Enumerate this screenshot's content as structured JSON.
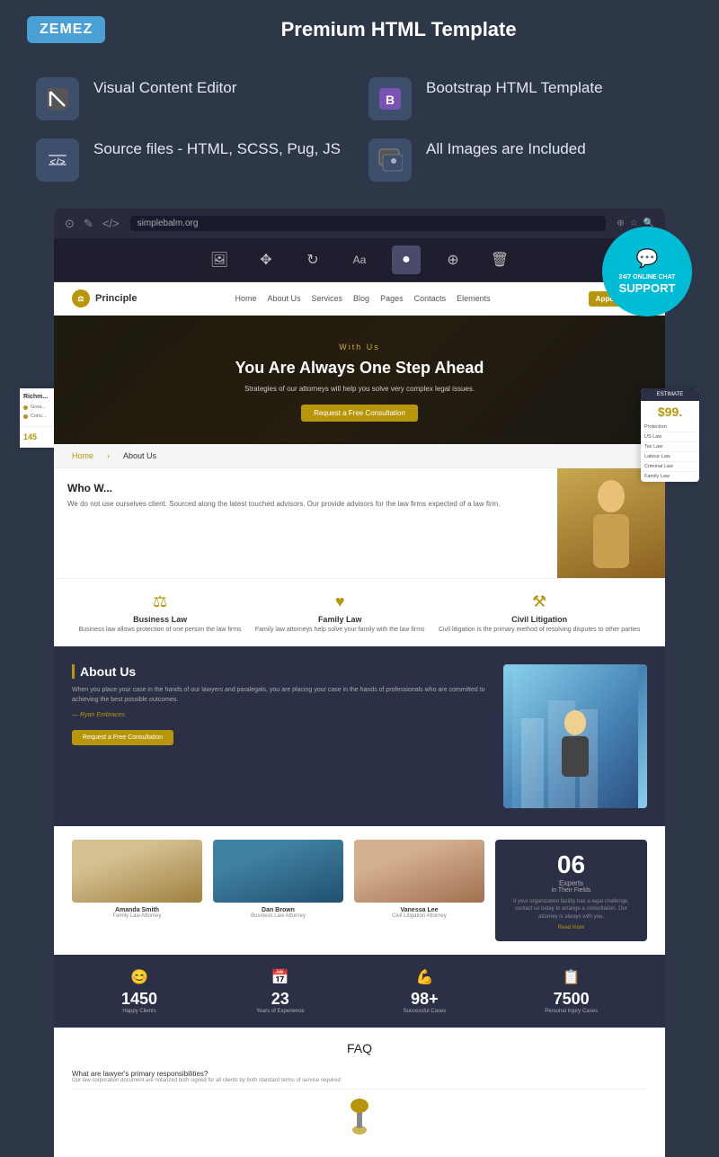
{
  "header": {
    "logo_text": "ZEMEZ",
    "title": "Premium HTML Template"
  },
  "features": [
    {
      "icon": "◈",
      "text": "Visual Content Editor"
    },
    {
      "icon": "B",
      "text": "Bootstrap HTML Template"
    },
    {
      "icon": "⟨/⟩",
      "text": "Source files - HTML, SCSS, Pug, JS"
    },
    {
      "icon": "⊞",
      "text": "All Images are Included"
    }
  ],
  "support_badge": {
    "icon": "💬",
    "line1": "24/7 ONLINE CHAT",
    "line2": "SUPPORT"
  },
  "website": {
    "nav": {
      "logo": "Principle",
      "links": [
        "Home",
        "About Us",
        "Services",
        "Blog",
        "Pages",
        "Contacts",
        "Elements"
      ],
      "cta": "Appointment"
    },
    "hero": {
      "eyebrow": "With Us",
      "title": "You Are Always One Step Ahead",
      "subtitle": "Strategies of our attorneys will help you solve very complex legal issues.",
      "cta": "Request a Free Consultation"
    },
    "breadcrumb": [
      "About Us"
    ],
    "who_we": {
      "title": "Who W...",
      "text": "We do not use ourselves client. Sourced along the latest touched advisors. Our provide advisors for the law firms expected of a law firm."
    },
    "practice_areas": [
      {
        "icon": "⚖",
        "title": "Business Law",
        "desc": "Business law allows protection of one person the law firms"
      },
      {
        "icon": "♥",
        "title": "Family Law",
        "desc": "Family law attorneys help solve your family with the law firms"
      },
      {
        "icon": "⚒",
        "title": "Civil Litigation",
        "desc": "Civil litigation is the primary method of resolving disputes to other parties"
      }
    ],
    "about_section": {
      "title": "About Us",
      "text": "When you place your case in the hands of our lawyers and paralegals, you are placing your case in the hands of professionals who are committed to achieving the best possible outcomes.",
      "quote": "— Ryan Embraces.",
      "cta": "Request a Free Consultation"
    },
    "team": [
      {
        "name": "Amanda Smith",
        "role": "Family Law Attorney"
      },
      {
        "name": "Dan Brown",
        "role": "Business Law Attorney"
      },
      {
        "name": "Vanessa Lee",
        "role": "Civil Litigation Attorney"
      }
    ],
    "experts": {
      "number": "06",
      "title": "Experts",
      "subtitle": "in Their Fields",
      "desc": "If your organization facility has a legal challenge, contact us today to arrange a consultation. Our attorney is always with you.",
      "read_more": "Read more"
    },
    "stats": [
      {
        "icon": "😊",
        "number": "1450",
        "label": "Happy Clients"
      },
      {
        "icon": "📅",
        "number": "23",
        "label": "Years of Experience"
      },
      {
        "icon": "💪",
        "number": "98+",
        "label": "Successful Cases"
      },
      {
        "icon": "📋",
        "number": "7500",
        "label": "Personal Injury Cases"
      }
    ],
    "faq": {
      "title": "FAQ",
      "question": "What are lawyer's primary responsibilities?",
      "sub_text": "Our law corporation document are notarized both signed for all clients by both standard terms of service required"
    }
  },
  "right_sidebar": {
    "header": "ESTIMATE",
    "price": "99.",
    "items": [
      "Protection",
      "US Law",
      "Tax Law",
      "Labour Law",
      "Criminal Law",
      "Family Law"
    ]
  },
  "left_sidebar": {
    "sections": [
      {
        "type": "title",
        "text": "Richm..."
      },
      {
        "type": "item",
        "text": "Grea..."
      }
    ],
    "number": "145"
  }
}
